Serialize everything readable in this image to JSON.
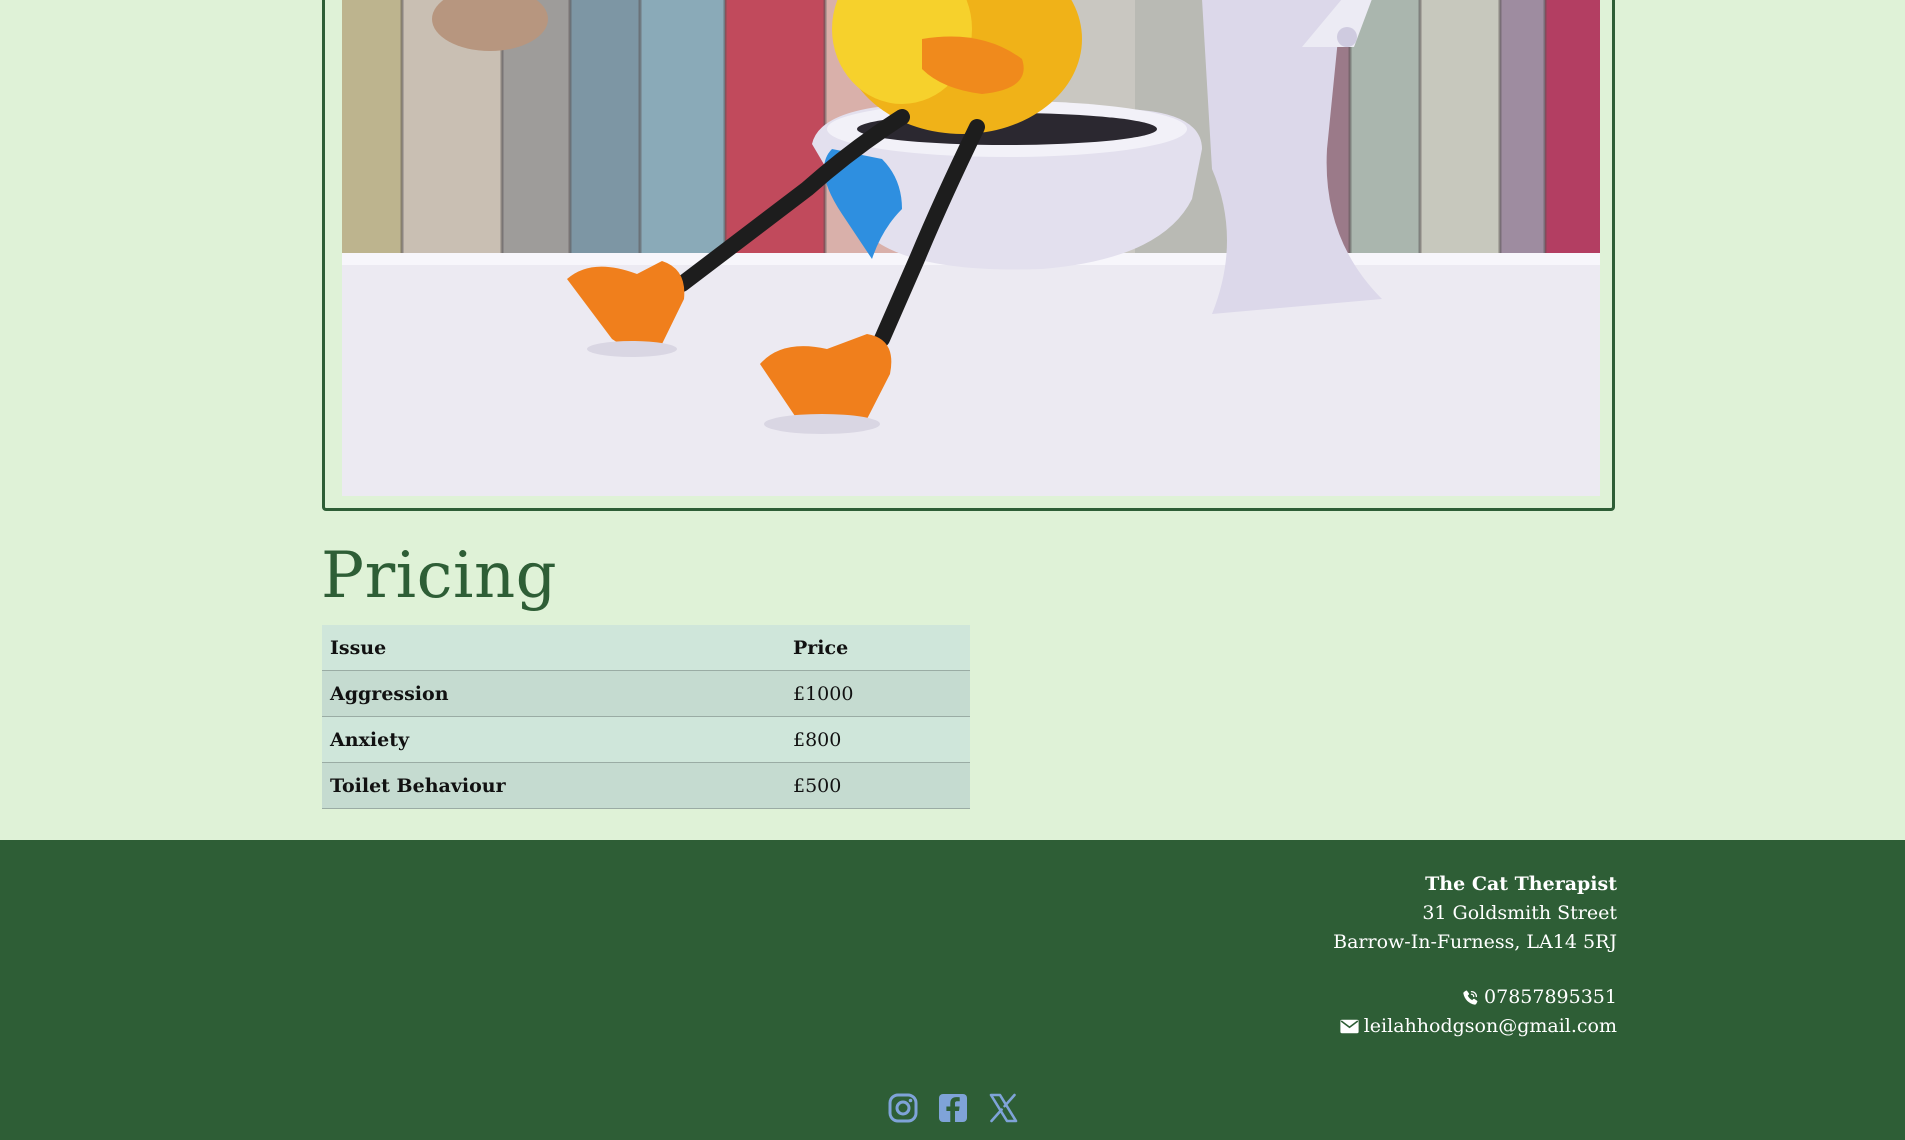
{
  "colors": {
    "page_background": "#dff2d7",
    "brand_green": "#2e5e36",
    "table_header": "#cfe6da",
    "table_row_alt": "#c5dbd0",
    "social_icon": "#7fa3d8"
  },
  "hero": {
    "image_icon": "duck-toilet-photo",
    "image_alt": ""
  },
  "pricing": {
    "title": "Pricing",
    "headers": {
      "issue": "Issue",
      "price": "Price"
    },
    "rows": [
      {
        "issue": "Aggression",
        "price": "£1000"
      },
      {
        "issue": "Anxiety",
        "price": "£800"
      },
      {
        "issue": "Toilet Behaviour",
        "price": "£500"
      }
    ]
  },
  "footer": {
    "business_name": "The Cat Therapist",
    "address_line1": "31 Goldsmith Street",
    "address_line2": "Barrow-In-Furness, LA14 5RJ",
    "phone_icon": "phone-icon",
    "phone": "07857895351",
    "email_icon": "envelope-icon",
    "email": "leilahhodgson@gmail.com",
    "social": [
      {
        "icon": "instagram-icon"
      },
      {
        "icon": "facebook-icon"
      },
      {
        "icon": "x-twitter-icon"
      }
    ]
  }
}
